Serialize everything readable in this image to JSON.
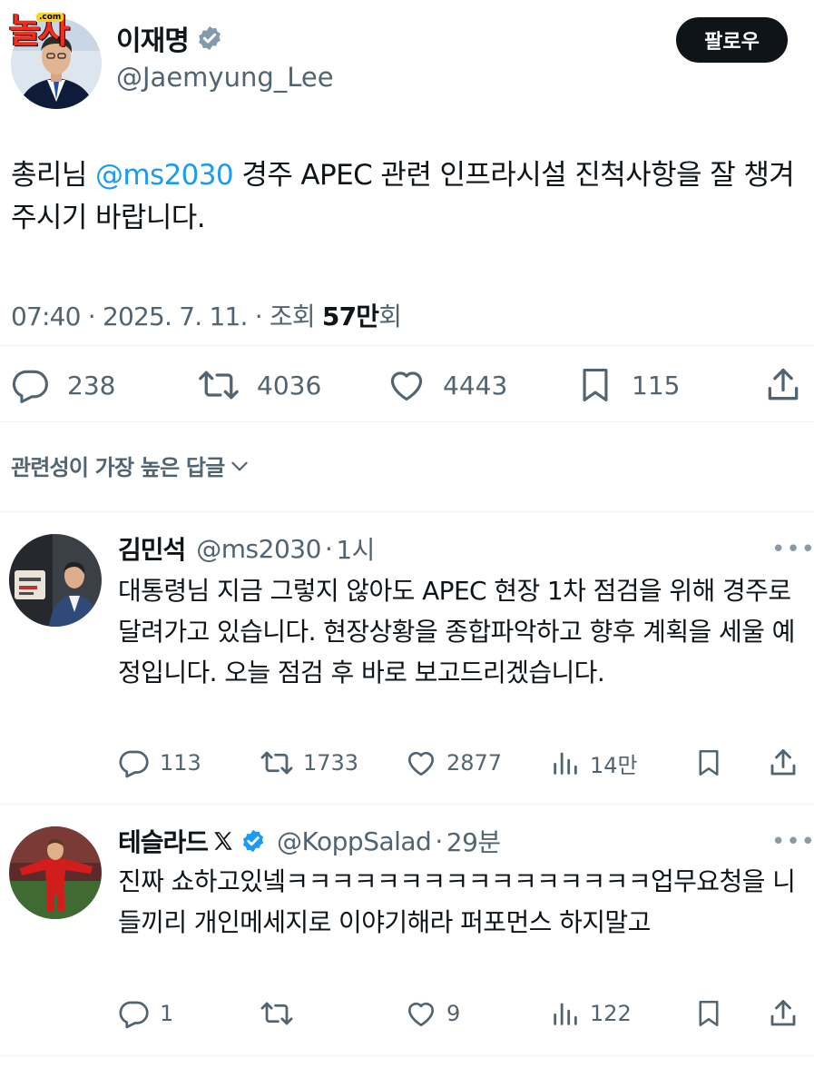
{
  "watermark": {
    "text": "놀자",
    "suffix": ".com"
  },
  "tweet": {
    "author_name": "이재명",
    "author_handle": "@Jaemyung_Lee",
    "follow_label": "팔로우",
    "text_before": "총리님 ",
    "mention": "@ms2030",
    "text_after": " 경주 APEC 관련 인프라시설 진척사항을 잘 챙겨주시기 바랍니다.",
    "time": "07:40 · 2025. 7. 11. · 조회 ",
    "views_bold": "57만",
    "views_suffix": "회",
    "stats": {
      "replies": "238",
      "reposts": "4036",
      "likes": "4443",
      "bookmarks": "115"
    }
  },
  "replies_header": {
    "label": "관련성이 가장 높은 답글"
  },
  "replies": [
    {
      "name": "김민석",
      "handle": "@ms2030",
      "time": "1시",
      "text": "대통령님 지금 그렇지 않아도 APEC 현장 1차 점검을 위해 경주로 달려가고 있습니다. 현장상황을 종합파악하고 향후 계획을 세울 예정입니다. 오늘 점검 후 바로 보고드리겠습니다.",
      "stats": {
        "replies": "113",
        "reposts": "1733",
        "likes": "2877",
        "views": "14만"
      }
    },
    {
      "name": "테슬라드",
      "handle": "@KoppSalad",
      "time": "29분",
      "text": "진짜 쇼하고있넼ㅋㅋㅋㅋㅋㅋㅋㅋㅋㅋㅋㅋㅋㅋㅋㅋ업무요청을 니들끼리 개인메세지로 이야기해라 퍼포먼스 하지말고",
      "stats": {
        "replies": "1",
        "reposts": "",
        "likes": "9",
        "views": "122"
      }
    }
  ],
  "colors": {
    "accent": "#1d9bf0",
    "text": "#0f1419",
    "muted": "#536471",
    "divider": "#eff3f4"
  }
}
